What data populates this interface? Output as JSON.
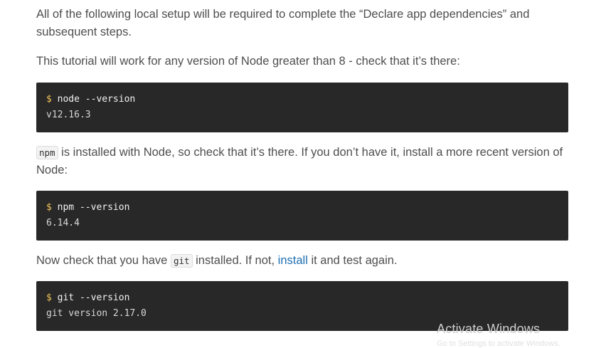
{
  "paragraphs": {
    "p1": "All of the following local setup will be required to complete the “Declare app dependencies” and subsequent steps.",
    "p2": "This tutorial will work for any version of Node greater than 8 - check that it’s there:",
    "p3_code": "npm",
    "p3_text": " is installed with Node, so check that it’s there. If you don’t have it, install a more recent version of Node:",
    "p4_before": "Now check that you have ",
    "p4_code": "git",
    "p4_middle": " installed. If not, ",
    "p4_link": "install",
    "p4_after": " it and test again."
  },
  "code_blocks": [
    {
      "prompt": "$",
      "command": " node --version",
      "output": "v12.16.3"
    },
    {
      "prompt": "$",
      "command": " npm --version",
      "output": "6.14.4"
    },
    {
      "prompt": "$",
      "command": " git --version",
      "output": "git version 2.17.0"
    }
  ],
  "watermark": {
    "title": "Activate Windows",
    "subtitle": "Go to Settings to activate Windows."
  },
  "colors": {
    "text": "#4e4e4e",
    "code_bg": "#282828",
    "prompt": "#f5c55a",
    "link": "#1f6fb2"
  }
}
